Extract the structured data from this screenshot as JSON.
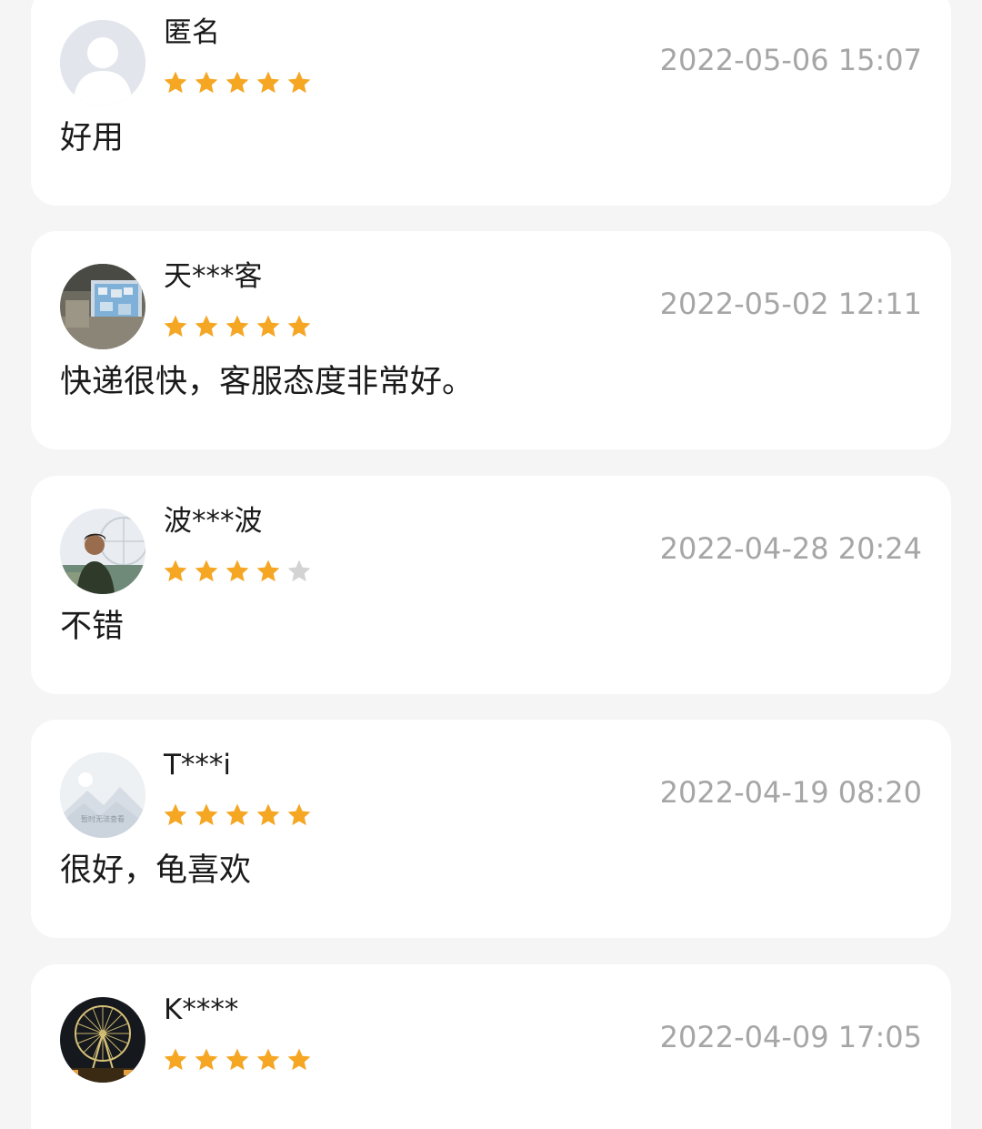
{
  "colors": {
    "page_background": "#f5f5f5",
    "card_background": "#ffffff",
    "star_filled": "#f5a623",
    "star_empty": "#d3d3d3",
    "timestamp_text": "#a6a6a6",
    "primary_text": "#1a1a1a"
  },
  "reviews": [
    {
      "username": "匿名",
      "avatar_icon": "default-user-avatar-icon",
      "rating": 5,
      "max_rating": 5,
      "timestamp": "2022-05-06 15:07",
      "comment": "好用"
    },
    {
      "username": "天***客",
      "avatar_icon": "user-photo-avatar-icon",
      "rating": 5,
      "max_rating": 5,
      "timestamp": "2022-05-02 12:11",
      "comment": "快递很快，客服态度非常好。"
    },
    {
      "username": "波***波",
      "avatar_icon": "user-photo-avatar-icon",
      "rating": 4,
      "max_rating": 5,
      "timestamp": "2022-04-28 20:24",
      "comment": "不错"
    },
    {
      "username": "T***i",
      "avatar_icon": "image-unavailable-avatar-icon",
      "avatar_caption": "暂时无法查看",
      "rating": 5,
      "max_rating": 5,
      "timestamp": "2022-04-19 08:20",
      "comment": "很好，龟喜欢"
    },
    {
      "username": "K****",
      "avatar_icon": "ferris-wheel-avatar-icon",
      "rating": 5,
      "max_rating": 5,
      "timestamp": "2022-04-09 17:05",
      "comment": ""
    }
  ]
}
